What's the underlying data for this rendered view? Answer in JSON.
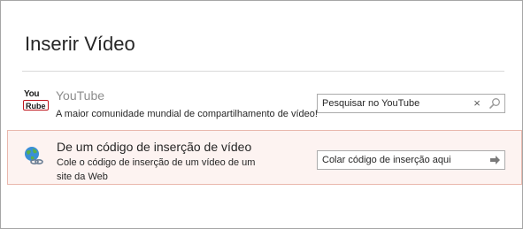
{
  "dialog": {
    "title": "Inserir Vídeo"
  },
  "youtube": {
    "icon_top": "You",
    "icon_bottom": "Rube",
    "title": "YouTube",
    "description": "A maior comunidade mundial de compartilhamento de vídeo!",
    "search_placeholder": "Pesquisar no YouTube",
    "clear_icon": "×",
    "search_icon": "search-icon"
  },
  "embed": {
    "title": "De um código de inserção de vídeo",
    "description": "Cole o código de inserção de um vídeo de um site da Web",
    "input_placeholder": "Colar código de inserção aqui",
    "go_icon": "arrow-right-icon",
    "icon": "globe-link-icon"
  },
  "colors": {
    "selected_bg": "#fdf3f1",
    "selected_border": "#e9b8ad",
    "youtube_red": "#c0171e",
    "muted_title": "#8c8c8c"
  }
}
